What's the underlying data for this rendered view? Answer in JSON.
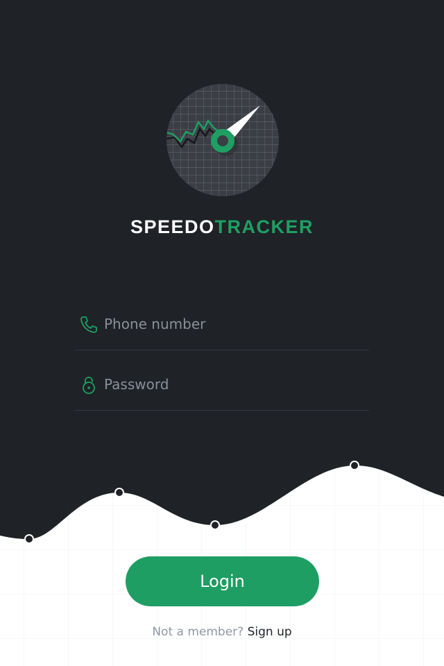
{
  "brand": {
    "part1": "SPEEDO",
    "part2": "TRACKER"
  },
  "form": {
    "phone": {
      "placeholder": "Phone number",
      "value": "",
      "icon": "phone-icon"
    },
    "password": {
      "placeholder": "Password",
      "value": "",
      "icon": "lock-icon"
    }
  },
  "actions": {
    "login_label": "Login",
    "signup_prompt": "Not a member?",
    "signup_link": "Sign up"
  },
  "colors": {
    "background_dark": "#1f2227",
    "accent_green": "#1e9e63",
    "surface_light": "#ffffff"
  }
}
